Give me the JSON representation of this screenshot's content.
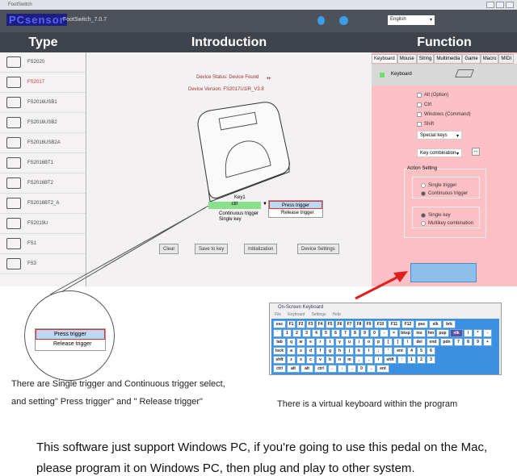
{
  "window": {
    "title": "FootSwitch",
    "app_version": "FootSwitch_7.0.7",
    "logo": "PCsensor",
    "language": "English"
  },
  "sections": {
    "type": "Type",
    "intro": "Introduction",
    "function": "Function"
  },
  "types": [
    "FS2020",
    "FS2017",
    "FS2016USB1",
    "FS2016USB2",
    "FS2016USB2A",
    "FS2016BT1",
    "FS2016BT2",
    "FS2016BT2_A",
    "FS2019U",
    "FS1",
    "FS3"
  ],
  "selected_type": "FS2017",
  "intro": {
    "status": "Device Status: Device Found",
    "version": "Device Version:   FS2017U1IR_V3.8",
    "key_label": "Key1",
    "key_value": "ctrl",
    "mode1": "Continuous trigger",
    "mode2": "Single key",
    "dropdown": [
      "Press trigger",
      "Release trigger"
    ],
    "buttons": [
      "Clear",
      "Save to key",
      "Initialization",
      "Device Settings"
    ]
  },
  "function": {
    "tabs": [
      "Keyboard",
      "Mouse",
      "String",
      "Multimedia",
      "Game",
      "Macro",
      "MIDI"
    ],
    "active_tab": "Keyboard",
    "bar_label": "Keyboard",
    "modifiers": [
      "Alt (Option)",
      "Ctrl",
      "Windows (Command)",
      "Shift"
    ],
    "special_keys": "Special keys",
    "key_combination": "Key combination",
    "more_button": "...",
    "action_setting": "Action Setting",
    "trigger": [
      "Single trigger",
      "Continuous trigger"
    ],
    "trigger_selected": "Continuous trigger",
    "keymode": [
      "Single key",
      "Multikey  combination"
    ],
    "keymode_selected": "Single key"
  },
  "osk": {
    "title": "On-Screen Keyboard",
    "menu": [
      "File",
      "Keyboard",
      "Settings",
      "Help"
    ],
    "rows": [
      [
        "esc",
        "F1",
        "F2",
        "F3",
        "F4",
        "F5",
        "F6",
        "F7",
        "F8",
        "F9",
        "F10",
        "F11",
        "F12",
        "psc",
        "slk",
        "brk"
      ],
      [
        "`",
        "1",
        "2",
        "3",
        "4",
        "5",
        "6",
        "7",
        "8",
        "9",
        "0",
        "-",
        "=",
        "bksp",
        "ins",
        "hm",
        "pup",
        "nlk",
        "/",
        "*",
        "-"
      ],
      [
        "tab",
        "q",
        "w",
        "e",
        "r",
        "t",
        "y",
        "u",
        "i",
        "o",
        "p",
        "[",
        "]",
        "\\",
        "del",
        "end",
        "pdn",
        "7",
        "8",
        "9",
        "+"
      ],
      [
        "lock",
        "a",
        "s",
        "d",
        "f",
        "g",
        "h",
        "j",
        "k",
        "l",
        ";",
        "'",
        "ent",
        "4",
        "5",
        "6"
      ],
      [
        "shft",
        "z",
        "x",
        "c",
        "v",
        "b",
        "n",
        "m",
        ",",
        ".",
        "/",
        "shft",
        "↑",
        "1",
        "2",
        "3"
      ],
      [
        "ctrl",
        "alt",
        "alt",
        "ctrl",
        "←",
        "↓",
        "→",
        "0",
        ".",
        "ent"
      ]
    ]
  },
  "captions": {
    "left1": "There are Single trigger and Continuous trigger select,",
    "left2": "and setting\" Press trigger\" and \" Release trigger\"",
    "right": "There is a virtual keyboard within the program",
    "bottom1": "This software just support Windows PC, if you're going to use this pedal on the Mac,",
    "bottom2": "please program it on Windows PC, then plug and play to other system."
  },
  "colors": {
    "header": "#4d525a",
    "function_bg": "#fdc0c4",
    "key_green": "#88e08a",
    "arrow": "#e02020"
  }
}
